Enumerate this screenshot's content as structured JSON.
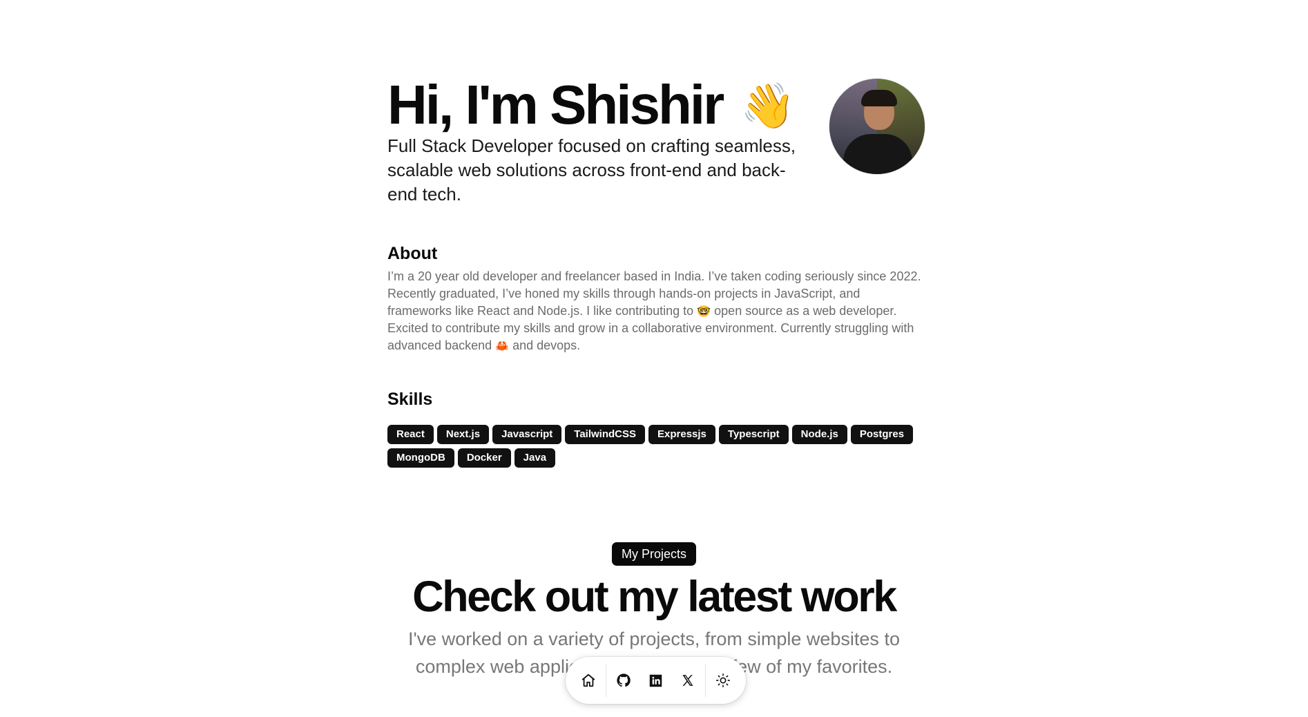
{
  "hero": {
    "title": "Hi, I'm Shishir",
    "wave_emoji": "👋",
    "subtitle": "Full Stack Developer focused on crafting seamless, scalable web solutions across front-end and back-end tech.",
    "avatar_icon": "profile-photo"
  },
  "about": {
    "heading": "About",
    "text_part1": "I’m a 20 year old developer and freelancer based in India. I’ve taken coding seriously since 2022. Recently graduated, I’ve honed my skills through hands-on projects in JavaScript, and frameworks like React and Node.js. I like contributing to",
    "emoji1": "🤓",
    "text_part2": "open source as a web developer. Excited to contribute my skills and grow in a collaborative environment. Currently struggling with advanced backend",
    "emoji2": "🦀",
    "text_part3": "and devops."
  },
  "skills": {
    "heading": "Skills",
    "items": [
      "React",
      "Next.js",
      "Javascript",
      "TailwindCSS",
      "Expressjs",
      "Typescript",
      "Node.js",
      "Postgres",
      "MongoDB",
      "Docker",
      "Java"
    ]
  },
  "projects": {
    "badge": "My Projects",
    "title": "Check out my latest work",
    "subtitle": "I've worked on a variety of projects, from simple websites to complex web applications. Here are a few of my favorites."
  },
  "dock": {
    "items": [
      {
        "icon": "home-icon"
      },
      {
        "icon": "github-icon"
      },
      {
        "icon": "linkedin-icon"
      },
      {
        "icon": "x-icon"
      },
      {
        "icon": "sun-icon"
      }
    ]
  }
}
